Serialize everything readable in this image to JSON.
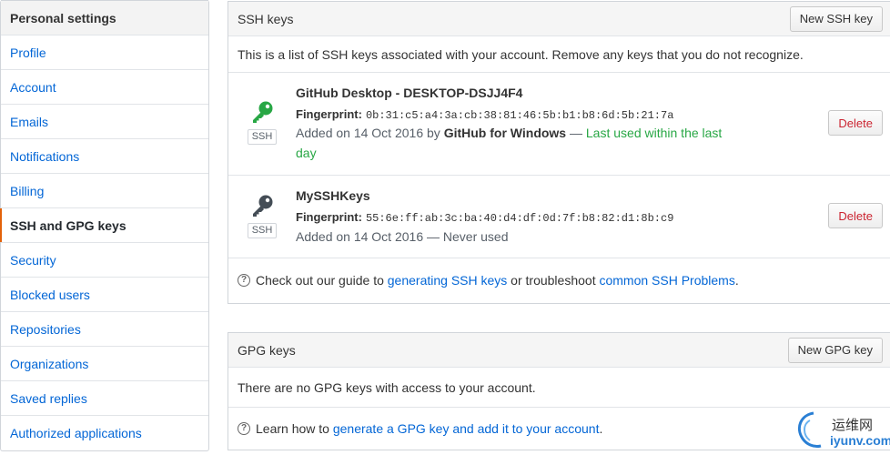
{
  "sidebar": {
    "header": "Personal settings",
    "items": [
      {
        "label": "Profile"
      },
      {
        "label": "Account"
      },
      {
        "label": "Emails"
      },
      {
        "label": "Notifications"
      },
      {
        "label": "Billing"
      },
      {
        "label": "SSH and GPG keys"
      },
      {
        "label": "Security"
      },
      {
        "label": "Blocked users"
      },
      {
        "label": "Repositories"
      },
      {
        "label": "Organizations"
      },
      {
        "label": "Saved replies"
      },
      {
        "label": "Authorized applications"
      }
    ]
  },
  "ssh": {
    "title": "SSH keys",
    "new_button": "New SSH key",
    "description": "This is a list of SSH keys associated with your account. Remove any keys that you do not recognize.",
    "keys": [
      {
        "name": "GitHub Desktop - DESKTOP-DSJJ4F4",
        "fingerprint_label": "Fingerprint:",
        "fingerprint": "0b:31:c5:a4:3a:cb:38:81:46:5b:b1:b8:6d:5b:21:7a",
        "added_prefix": "Added on 14 Oct 2016 by ",
        "added_by": "GitHub for Windows",
        "added_sep": " — ",
        "usage": "Last used within the last day",
        "type": "SSH",
        "icon_color": "#28a745",
        "delete_label": "Delete"
      },
      {
        "name": "MySSHKeys",
        "fingerprint_label": "Fingerprint:",
        "fingerprint": "55:6e:ff:ab:3c:ba:40:d4:df:0d:7f:b8:82:d1:8b:c9",
        "added_text": "Added on 14 Oct 2016 — Never used",
        "type": "SSH",
        "icon_color": "#444d56",
        "delete_label": "Delete"
      }
    ],
    "help": {
      "prefix": "Check out our guide to ",
      "link1": "generating SSH keys",
      "middle": " or troubleshoot ",
      "link2": "common SSH Problems",
      "suffix": "."
    }
  },
  "gpg": {
    "title": "GPG keys",
    "new_button": "New GPG key",
    "empty": "There are no GPG keys with access to your account.",
    "help": {
      "prefix": "Learn how to ",
      "link": "generate a GPG key and add it to your account",
      "suffix": "."
    }
  },
  "watermark": {
    "line1": "运维网",
    "line2": "iyunv.com"
  },
  "colors": {
    "link": "#0366d6",
    "selected_accent": "#e36209",
    "recent_green": "#28a745",
    "danger": "#cb2431"
  }
}
